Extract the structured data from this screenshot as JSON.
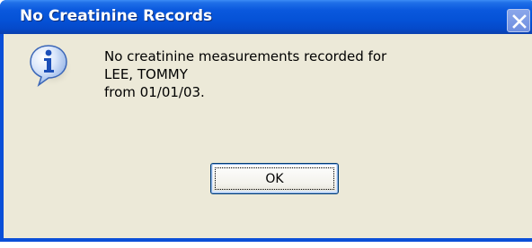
{
  "window": {
    "title": "No Creatinine Records"
  },
  "icons": {
    "dialog": "information-icon",
    "close": "close-icon"
  },
  "message": {
    "lines": [
      "No creatinine measurements recorded for",
      "LEE, TOMMY",
      "from 01/01/03."
    ]
  },
  "buttons": {
    "ok_label": "OK"
  },
  "colors": {
    "titlebar": "#0552d6",
    "client_background": "#ece9d8",
    "title_text": "#ffffff"
  }
}
